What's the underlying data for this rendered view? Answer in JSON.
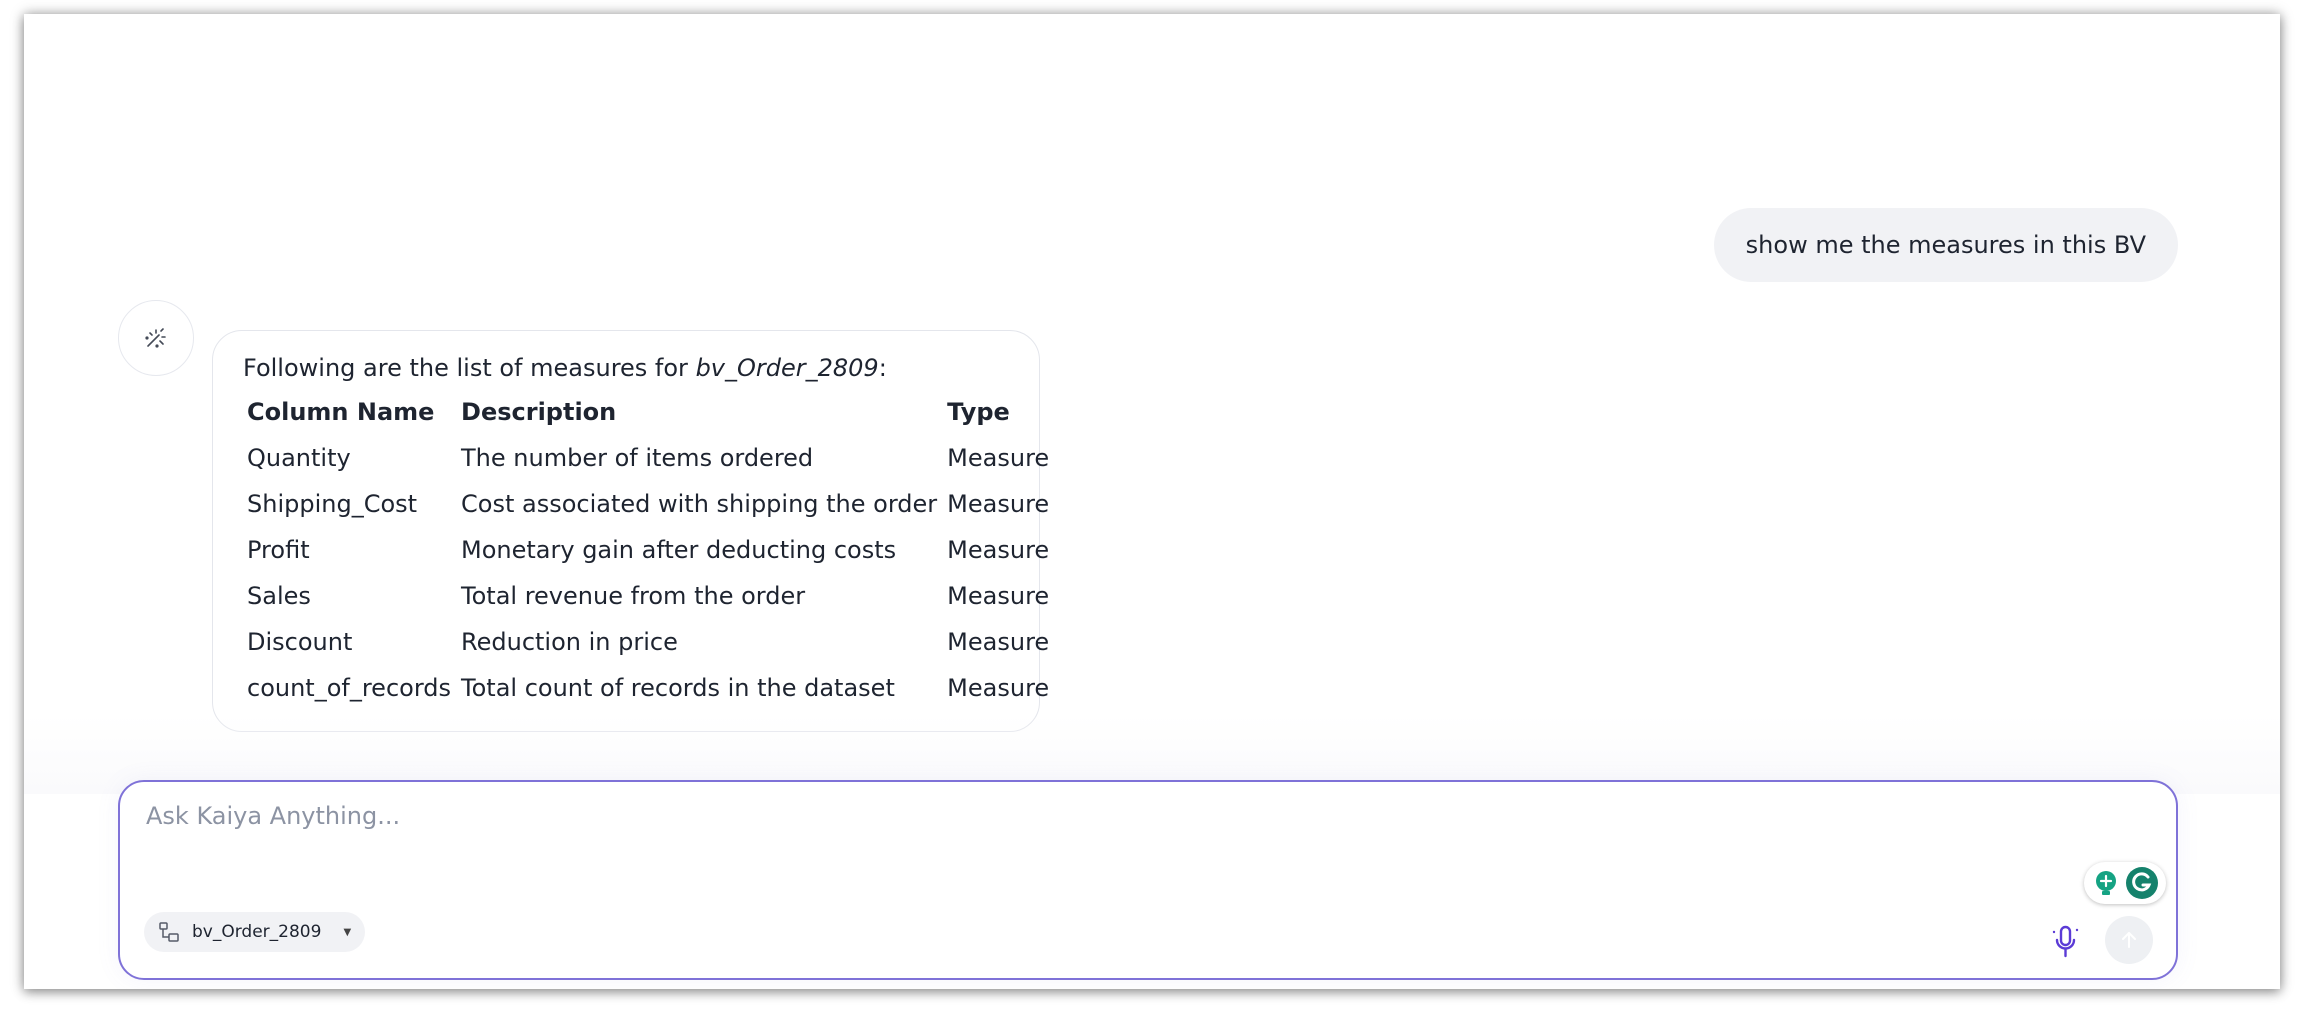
{
  "conversation": {
    "user_message": "show me the measures in this BV",
    "answer": {
      "intro_prefix": "Following are the list of measures for ",
      "intro_bv": "bv_Order_2809",
      "intro_suffix": ":",
      "table": {
        "headers": [
          "Column Name",
          "Description",
          "Type"
        ],
        "rows": [
          [
            "Quantity",
            "The number of items ordered",
            "Measure"
          ],
          [
            "Shipping_Cost",
            "Cost associated with shipping the order",
            "Measure"
          ],
          [
            "Profit",
            "Monetary gain after deducting costs",
            "Measure"
          ],
          [
            "Sales",
            "Total revenue from the order",
            "Measure"
          ],
          [
            "Discount",
            "Reduction in price",
            "Measure"
          ],
          [
            "count_of_records",
            "Total count of records in the dataset",
            "Measure"
          ]
        ]
      }
    }
  },
  "composer": {
    "placeholder": "Ask Kaiya Anything...",
    "value": "",
    "data_source": "bv_Order_2809"
  },
  "icons": {
    "avatar": "magic-wand-icon",
    "source": "worksheet-icon",
    "dropdown": "caret-down-icon",
    "extension_1": "lightbulb-plus-icon",
    "extension_2": "grammarly-icon",
    "mic": "microphone-icon",
    "send": "arrow-up-icon"
  },
  "colors": {
    "accent": "#7f72d8",
    "mic": "#5b3bd6",
    "grammarly": "#15826c"
  }
}
